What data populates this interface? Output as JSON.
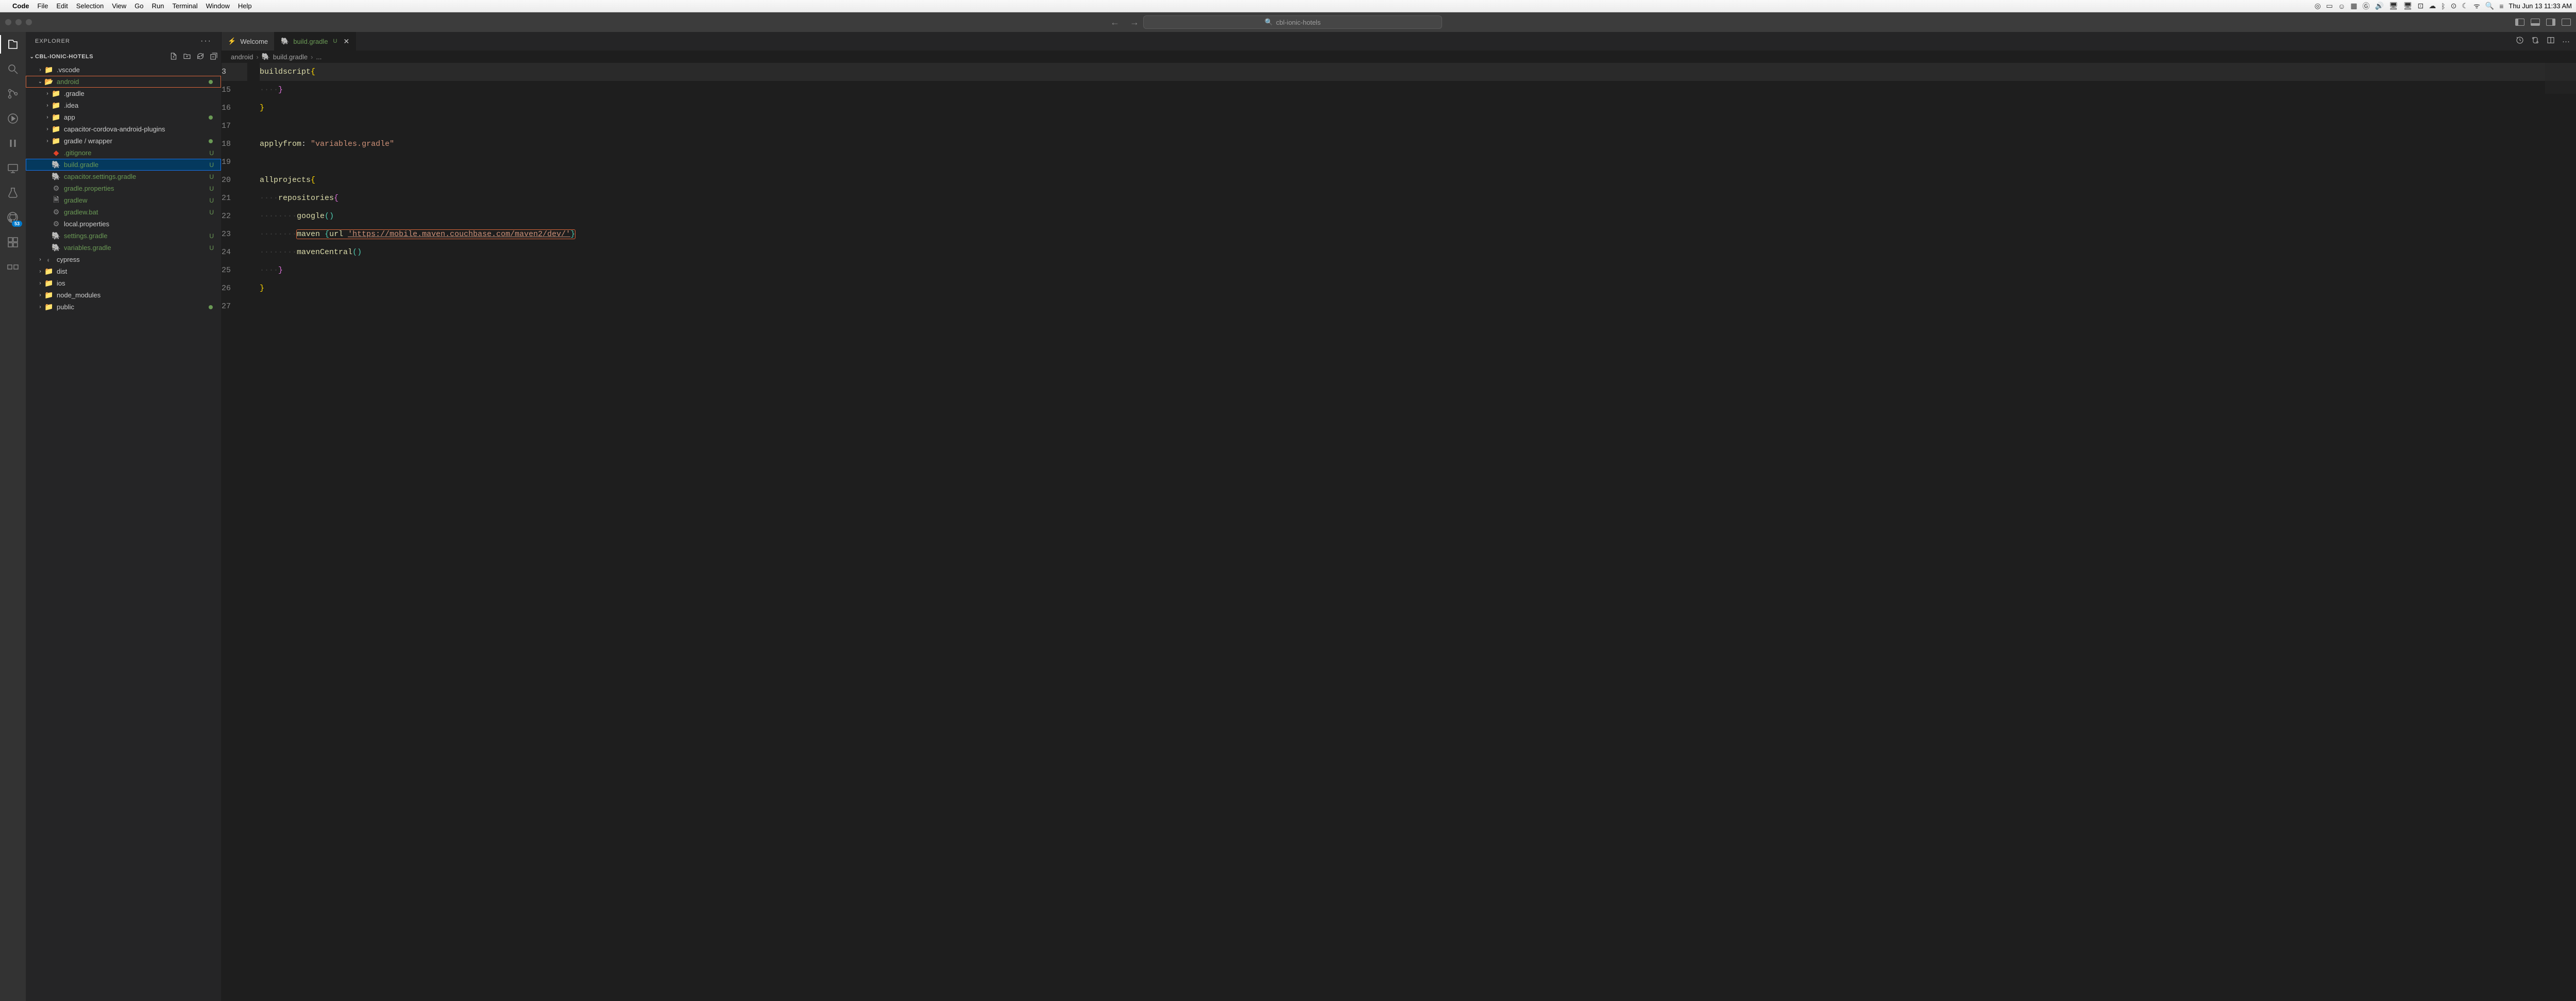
{
  "macos": {
    "app": "Code",
    "menus": [
      "File",
      "Edit",
      "Selection",
      "View",
      "Go",
      "Run",
      "Terminal",
      "Window",
      "Help"
    ],
    "clock": "Thu Jun 13  11:33 AM"
  },
  "titlebar": {
    "command_center": "cbl-ionic-hotels"
  },
  "activity": {
    "git_badge": "53"
  },
  "sidebar": {
    "title": "EXPLORER",
    "section": "CBL-IONIC-HOTELS",
    "tree": [
      {
        "indent": 1,
        "chevron": ">",
        "icon": "folder",
        "label": ".vscode",
        "status": "",
        "color": ""
      },
      {
        "indent": 1,
        "chevron": "v",
        "icon": "folder-open-green",
        "label": "android",
        "status": "dot",
        "color": "git-u",
        "highlight": "orange"
      },
      {
        "indent": 2,
        "chevron": ">",
        "icon": "folder-idea",
        "label": ".gradle",
        "status": "",
        "color": ""
      },
      {
        "indent": 2,
        "chevron": ">",
        "icon": "folder-idea",
        "label": ".idea",
        "status": "",
        "color": ""
      },
      {
        "indent": 2,
        "chevron": ">",
        "icon": "folder",
        "label": "app",
        "status": "dot",
        "color": ""
      },
      {
        "indent": 2,
        "chevron": ">",
        "icon": "folder",
        "label": "capacitor-cordova-android-plugins",
        "status": "",
        "color": ""
      },
      {
        "indent": 2,
        "chevron": ">",
        "icon": "folder",
        "label": "gradle / wrapper",
        "status": "dot",
        "color": ""
      },
      {
        "indent": 2,
        "chevron": "",
        "icon": "git",
        "label": ".gitignore",
        "status": "U",
        "color": "git-u"
      },
      {
        "indent": 2,
        "chevron": "",
        "icon": "gradle",
        "label": "build.gradle",
        "status": "U",
        "color": "git-u",
        "selected": true,
        "highlight": "blue"
      },
      {
        "indent": 2,
        "chevron": "",
        "icon": "gradle",
        "label": "capacitor.settings.gradle",
        "status": "U",
        "color": "git-u"
      },
      {
        "indent": 2,
        "chevron": "",
        "icon": "gear",
        "label": "gradle.properties",
        "status": "U",
        "color": "git-u"
      },
      {
        "indent": 2,
        "chevron": "",
        "icon": "file",
        "label": "gradlew",
        "status": "U",
        "color": "git-u"
      },
      {
        "indent": 2,
        "chevron": "",
        "icon": "gear",
        "label": "gradlew.bat",
        "status": "U",
        "color": "git-u"
      },
      {
        "indent": 2,
        "chevron": "",
        "icon": "gear",
        "label": "local.properties",
        "status": "",
        "color": ""
      },
      {
        "indent": 2,
        "chevron": "",
        "icon": "gradle",
        "label": "settings.gradle",
        "status": "U",
        "color": "git-u"
      },
      {
        "indent": 2,
        "chevron": "",
        "icon": "gradle",
        "label": "variables.gradle",
        "status": "U",
        "color": "git-u"
      },
      {
        "indent": 1,
        "chevron": ">",
        "icon": "folder-cypress",
        "label": "cypress",
        "status": "",
        "color": ""
      },
      {
        "indent": 1,
        "chevron": ">",
        "icon": "folder",
        "label": "dist",
        "status": "",
        "color": ""
      },
      {
        "indent": 1,
        "chevron": ">",
        "icon": "folder-apple",
        "label": "ios",
        "status": "",
        "color": ""
      },
      {
        "indent": 1,
        "chevron": ">",
        "icon": "folder-node",
        "label": "node_modules",
        "status": "",
        "color": ""
      },
      {
        "indent": 1,
        "chevron": ">",
        "icon": "folder",
        "label": "public",
        "status": "dot",
        "color": ""
      }
    ]
  },
  "tabs": [
    {
      "icon": "vscode",
      "label": "Welcome",
      "active": false
    },
    {
      "icon": "gradle",
      "label": "build.gradle",
      "modified": "U",
      "active": true,
      "close": true
    }
  ],
  "breadcrumb": [
    "android",
    "build.gradle",
    "..."
  ],
  "code_lines": [
    {
      "n": 3,
      "html": "<span class='tok-func'>buildscript</span> <span class='tok-brace'>{</span>",
      "current": true
    },
    {
      "n": 15,
      "html": "<span class='indent'>····</span><span class='tok-brace2'>}</span>"
    },
    {
      "n": 16,
      "html": "<span class='tok-brace'>}</span>"
    },
    {
      "n": 17,
      "html": ""
    },
    {
      "n": 18,
      "html": "<span class='tok-func'>apply</span> <span class='tok-func'>from</span>: <span class='tok-string'>\"variables.gradle\"</span>"
    },
    {
      "n": 19,
      "html": ""
    },
    {
      "n": 20,
      "html": "<span class='tok-func'>allprojects</span> <span class='tok-brace'>{</span>"
    },
    {
      "n": 21,
      "html": "<span class='indent'>····</span><span class='tok-func'>repositories</span> <span class='tok-brace2'>{</span>"
    },
    {
      "n": 22,
      "html": "<span class='indent'>····</span><span class='indent'>····</span><span class='tok-func'>google</span><span class='tok-brace3'>(</span><span class='tok-brace3'>)</span>"
    },
    {
      "n": 23,
      "html": "<span class='indent'>····</span><span class='indent'>····</span><span class='highlight-code-box'><span class='tok-func'>maven</span> <span class='tok-brace3'>{</span><span class='tok-func'>url</span> <span class='tok-string tok-url'>'https://mobile.maven.couchbase.com/maven2/dev/'</span><span class='tok-brace3'>}</span></span>"
    },
    {
      "n": 24,
      "html": "<span class='indent'>····</span><span class='indent'>····</span><span class='tok-func'>mavenCentral</span><span class='tok-brace3'>(</span><span class='tok-brace3'>)</span>"
    },
    {
      "n": 25,
      "html": "<span class='indent'>····</span><span class='tok-brace2'>}</span>"
    },
    {
      "n": 26,
      "html": "<span class='tok-brace'>}</span>"
    },
    {
      "n": 27,
      "html": ""
    }
  ]
}
